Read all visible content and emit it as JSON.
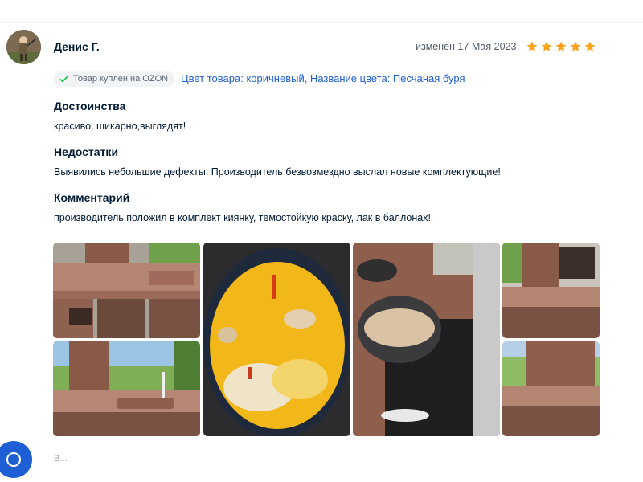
{
  "review": {
    "author": "Денис Г.",
    "date": "изменен 17 Мая 2023",
    "rating": 5,
    "badge": {
      "label": "Товар куплен на OZON",
      "icon": "check-icon",
      "color": "#10c44c"
    },
    "product_variant": "Цвет товара: коричневый, Название цвета: Песчаная буря",
    "sections": [
      {
        "title": "Достоинства",
        "text": "красиво, шикарно,выглядят!"
      },
      {
        "title": "Недостатки",
        "text": "Выявились небольшие дефекты. Производитель безвозмездно выслал новые комплектующие!"
      },
      {
        "title": "Комментарий",
        "text": "производитель положил в комплект киянку, темостойкую краску, лак в баллонах!"
      }
    ],
    "photos": [
      "outdoor-kitchen-photo",
      "outdoor-sink-photo",
      "cauldron-pilaf-photo",
      "cauldron-cooking-photo",
      "grill-photo",
      "stone-pillar-photo"
    ]
  },
  "footer": {
    "partial_text": "В..."
  },
  "colors": {
    "star": "#f9a21b",
    "link": "#1f5fd6",
    "badge_bg": "#f2f3f5",
    "fab": "#1f5fd6"
  }
}
